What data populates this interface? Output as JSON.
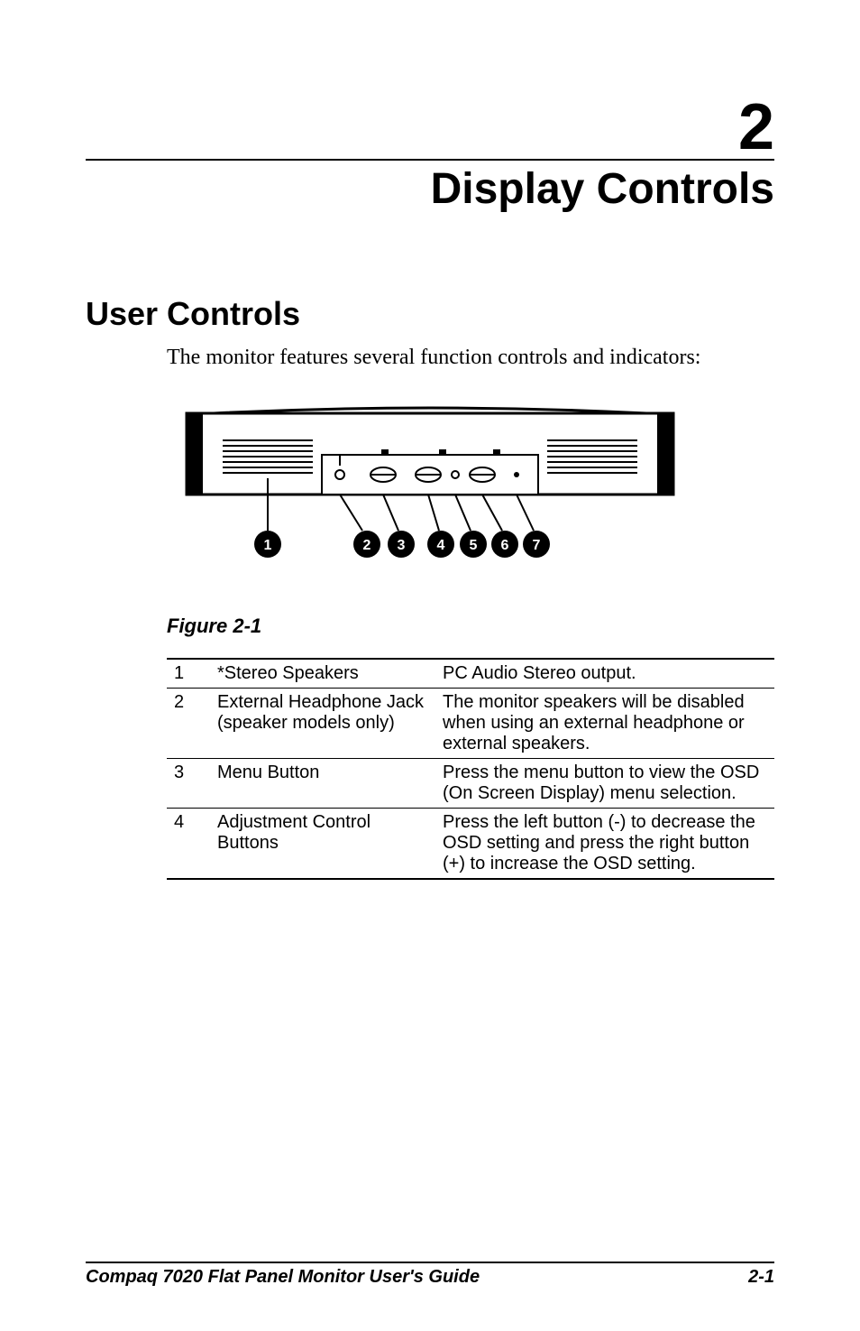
{
  "chapter": {
    "number": "2",
    "title": "Display Controls"
  },
  "section": {
    "heading": "User Controls",
    "body": "The monitor features several function controls and indicators:"
  },
  "figure": {
    "caption": "Figure 2-1"
  },
  "table": {
    "rows": [
      {
        "num": "1",
        "name": "*Stereo Speakers",
        "desc": "PC Audio Stereo output."
      },
      {
        "num": "2",
        "name": "External Headphone Jack (speaker models only)",
        "desc": "The monitor speakers will be disabled when using an external headphone or external speakers."
      },
      {
        "num": "3",
        "name": "Menu Button",
        "desc": "Press the menu button to view the OSD (On Screen Display) menu selection."
      },
      {
        "num": "4",
        "name": "Adjustment Control Buttons",
        "desc": "Press the left button (-) to decrease the OSD setting and press the right button (+) to increase the OSD setting."
      }
    ]
  },
  "footer": {
    "left": "Compaq 7020 Flat Panel Monitor User's Guide",
    "right": "2-1"
  },
  "chart_data": {
    "type": "table",
    "title": "Figure 2-1 monitor front-panel controls legend",
    "columns": [
      "Number",
      "Control",
      "Description"
    ],
    "rows": [
      [
        "1",
        "*Stereo Speakers",
        "PC Audio Stereo output."
      ],
      [
        "2",
        "External Headphone Jack (speaker models only)",
        "The monitor speakers will be disabled when using an external headphone or external speakers."
      ],
      [
        "3",
        "Menu Button",
        "Press the menu button to view the OSD (On Screen Display) menu selection."
      ],
      [
        "4",
        "Adjustment Control Buttons",
        "Press the left button (-) to decrease the OSD setting and press the right button (+) to increase the OSD setting."
      ]
    ]
  }
}
